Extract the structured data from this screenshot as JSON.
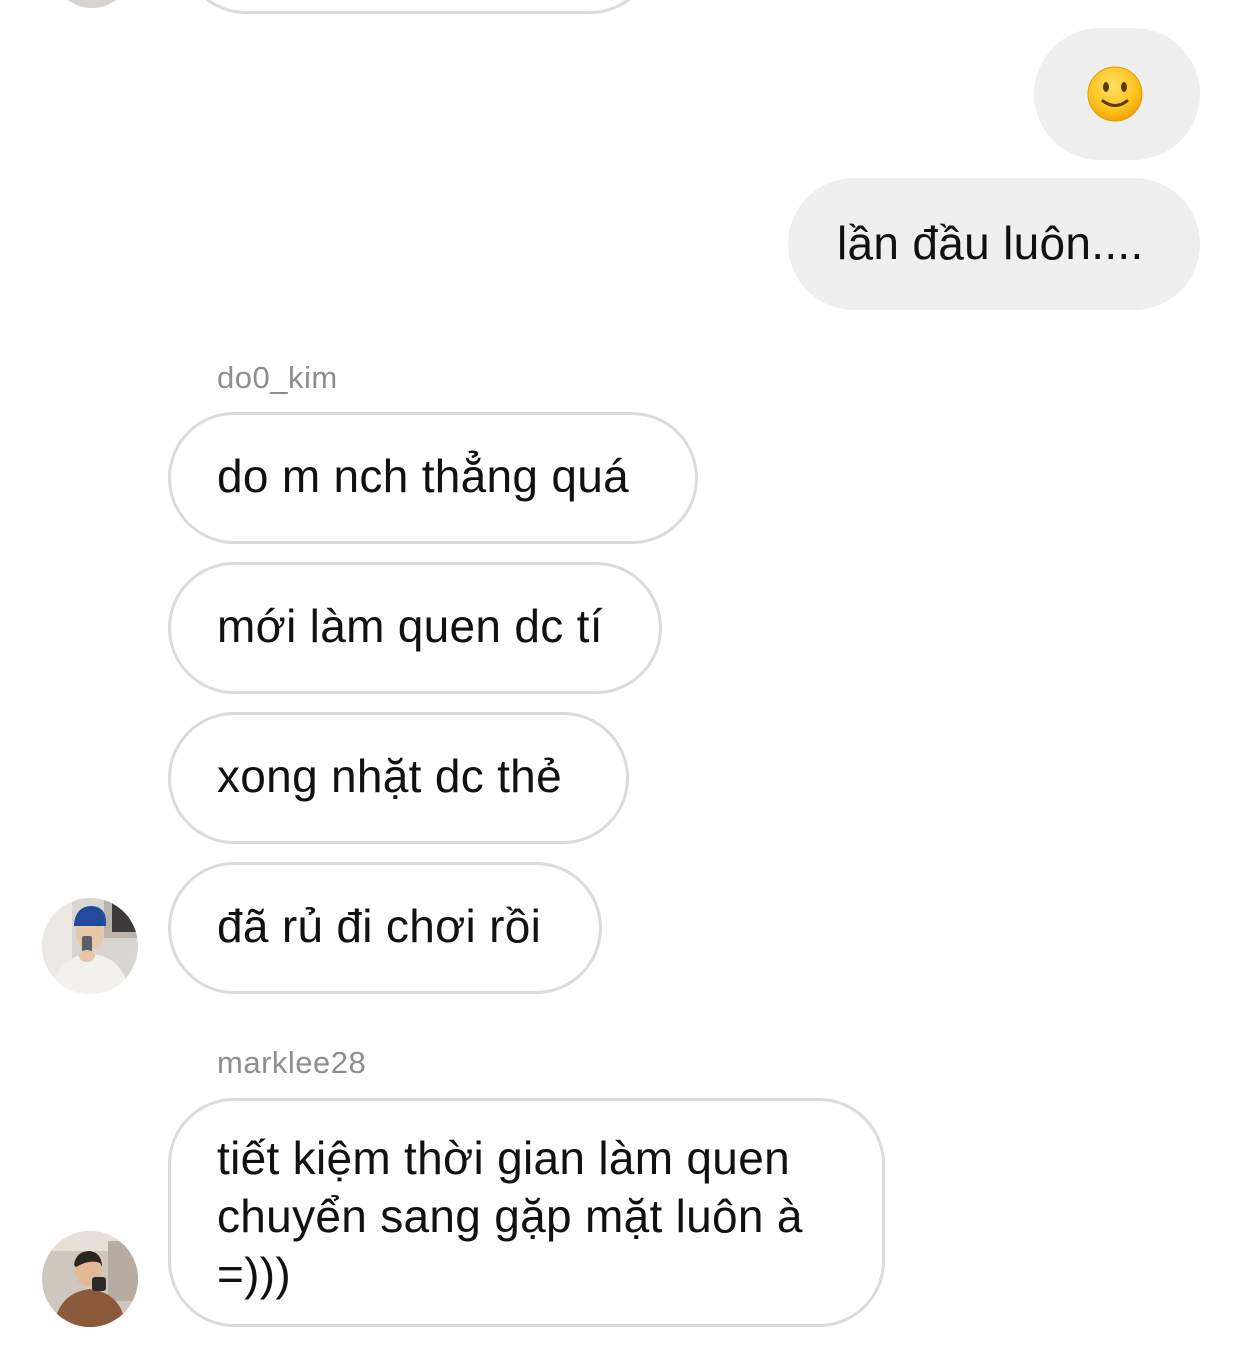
{
  "messages": {
    "outgoing_emoji": {
      "icon": "slightly-smiling-face-emoji"
    },
    "outgoing_text": "lần đầu luôn....",
    "group1": {
      "sender": "do0_kim",
      "lines": [
        "do m nch thẳng quá",
        "mới làm quen dc tí",
        "xong nhặt dc thẻ",
        "đã rủ đi chơi rồi"
      ]
    },
    "group2": {
      "sender": "marklee28",
      "text_lines": [
        "tiết kiệm thời gian làm quen",
        "chuyển sang gặp mặt luôn à",
        "=)))"
      ]
    }
  },
  "colors": {
    "outgoing_bubble": "#efefef",
    "incoming_border": "#dbdbdb",
    "sender_text": "#8e8e8e"
  }
}
